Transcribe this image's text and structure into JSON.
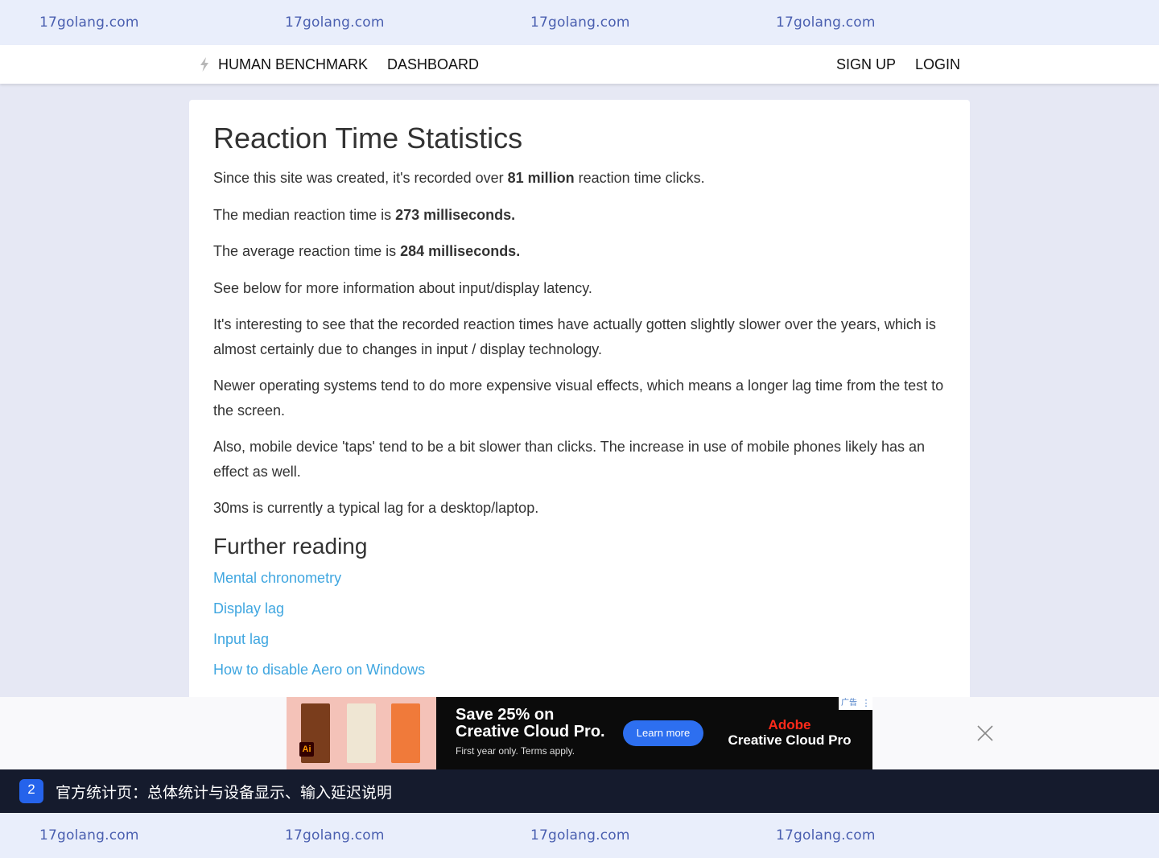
{
  "watermark": {
    "top": [
      "17golang.com",
      "17golang.com",
      "17golang.com",
      "17golang.com"
    ],
    "bottom": [
      "17golang.com",
      "17golang.com",
      "17golang.com",
      "17golang.com"
    ]
  },
  "nav": {
    "brand": "HUMAN BENCHMARK",
    "dashboard": "DASHBOARD",
    "signup": "SIGN UP",
    "login": "LOGIN"
  },
  "article": {
    "title": "Reaction Time Statistics",
    "p1_pre": "Since this site was created, it's recorded over ",
    "p1_bold": "81 million",
    "p1_post": " reaction time clicks.",
    "p2_pre": "The median reaction time is ",
    "p2_bold": "273 milliseconds.",
    "p3_pre": "The average reaction time is ",
    "p3_bold": "284 milliseconds.",
    "p4": "See below for more information about input/display latency.",
    "p5": "It's interesting to see that the recorded reaction times have actually gotten slightly slower over the years, which is almost certainly due to changes in input / display technology.",
    "p6": "Newer operating systems tend to do more expensive visual effects, which means a longer lag time from the test to the screen.",
    "p7": "Also, mobile device 'taps' tend to be a bit slower than clicks. The increase in use of mobile phones likely has an effect as well.",
    "p8": "30ms is currently a typical lag for a desktop/laptop.",
    "further_title": "Further reading",
    "links": [
      "Mental chronometry",
      "Display lag",
      "Input lag",
      "How to disable Aero on Windows"
    ]
  },
  "ad": {
    "headline_1": "Save 25% on",
    "headline_2": "Creative Cloud Pro.",
    "subtext": "First year only. Terms apply.",
    "button": "Learn more",
    "brand_1": "Adobe",
    "brand_2": "Creative Cloud Pro",
    "tag": "广告",
    "info": "⋮",
    "ai_logo": "Ai"
  },
  "caption": {
    "number": "2",
    "text": "官方统计页：总体统计与设备显示、输入延迟说明"
  },
  "colors": {
    "link": "#3fa6e0",
    "page_bg": "#e6e8f4",
    "watermark": "#4a5fb0",
    "caption_bg": "#151b2d",
    "ad_button": "#2d6ff0"
  }
}
